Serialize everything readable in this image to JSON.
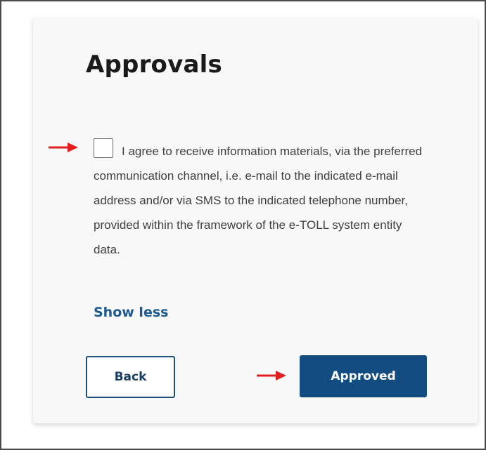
{
  "approvals": {
    "title": "Approvals",
    "consent_checked": false,
    "consent_text": "I agree to receive information materials, via the preferred communication channel, i.e. e-mail to the indicated e-mail address and/or via SMS to the indicated telephone number, provided within the framework of the e-TOLL system entity data.",
    "show_less_label": "Show less",
    "back_label": "Back",
    "approved_label": "Approved"
  },
  "annotations": {
    "arrow_color": "#e02020",
    "arrow_icon": "right-arrow-icon"
  },
  "colors": {
    "primary": "#124c80",
    "link": "#1d5a92",
    "text": "#404040",
    "heading": "#1a1a1a"
  }
}
